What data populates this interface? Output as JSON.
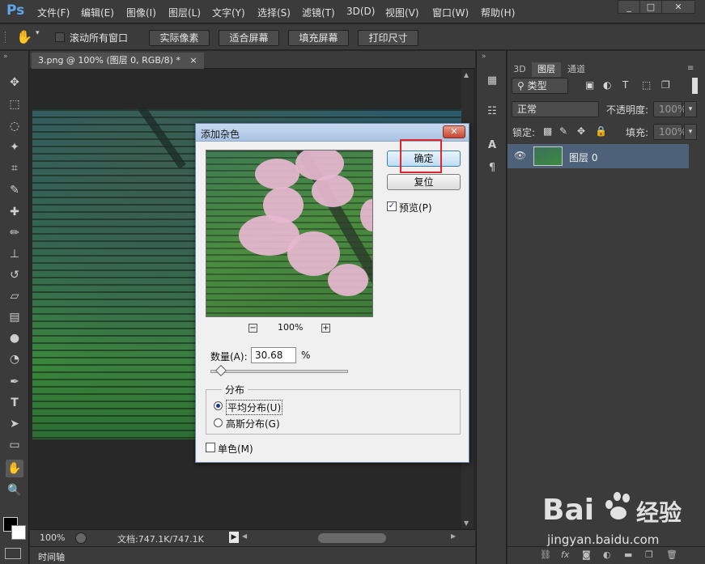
{
  "app": {
    "logo": "Ps"
  },
  "menu": [
    "文件(F)",
    "编辑(E)",
    "图像(I)",
    "图层(L)",
    "文字(Y)",
    "选择(S)",
    "滤镜(T)",
    "3D(D)",
    "视图(V)",
    "窗口(W)",
    "帮助(H)"
  ],
  "window_controls": [
    "_",
    "□",
    "✕"
  ],
  "options_bar": {
    "scroll_all_label": "滚动所有窗口",
    "buttons": [
      "实际像素",
      "适合屏幕",
      "填充屏幕",
      "打印尺寸"
    ]
  },
  "document": {
    "tab_title": "3.png @ 100% (图层 0, RGB/8) *",
    "tab_close": "×"
  },
  "status": {
    "zoom": "100%",
    "doc_info": "文档:747.1K/747.1K"
  },
  "timeline": {
    "label": "时间轴"
  },
  "layers_panel": {
    "tabs": [
      "3D",
      "图层",
      "通道"
    ],
    "filter_type": "类型",
    "blend_mode": "正常",
    "opacity_label": "不透明度:",
    "opacity_value": "100%",
    "lock_label": "锁定:",
    "fill_label": "填充:",
    "fill_value": "100%",
    "layer_name": "图层 0"
  },
  "dialog": {
    "title": "添加杂色",
    "close": "✕",
    "ok": "确定",
    "reset": "复位",
    "preview_label": "预览(P)",
    "preview_checked": true,
    "zoom_minus": "−",
    "zoom_plus": "+",
    "zoom": "100%",
    "amount_label": "数量(A):",
    "amount_value": "30.68",
    "amount_unit": "%",
    "amount_slider_percent": 7.7,
    "distribution_title": "分布",
    "uniform_label": "平均分布(U)",
    "gaussian_label": "高斯分布(G)",
    "selected_distribution": "uniform",
    "mono_label": "单色(M)",
    "mono_checked": false
  },
  "watermark": {
    "brand": "Bai",
    "brand2": "经验",
    "url": "jingyan.baidu.com"
  },
  "colors": {
    "highlight_box": "#e0262b",
    "ui_dark": "#3b3b3b",
    "dialog_bg": "#f0f0f0"
  }
}
